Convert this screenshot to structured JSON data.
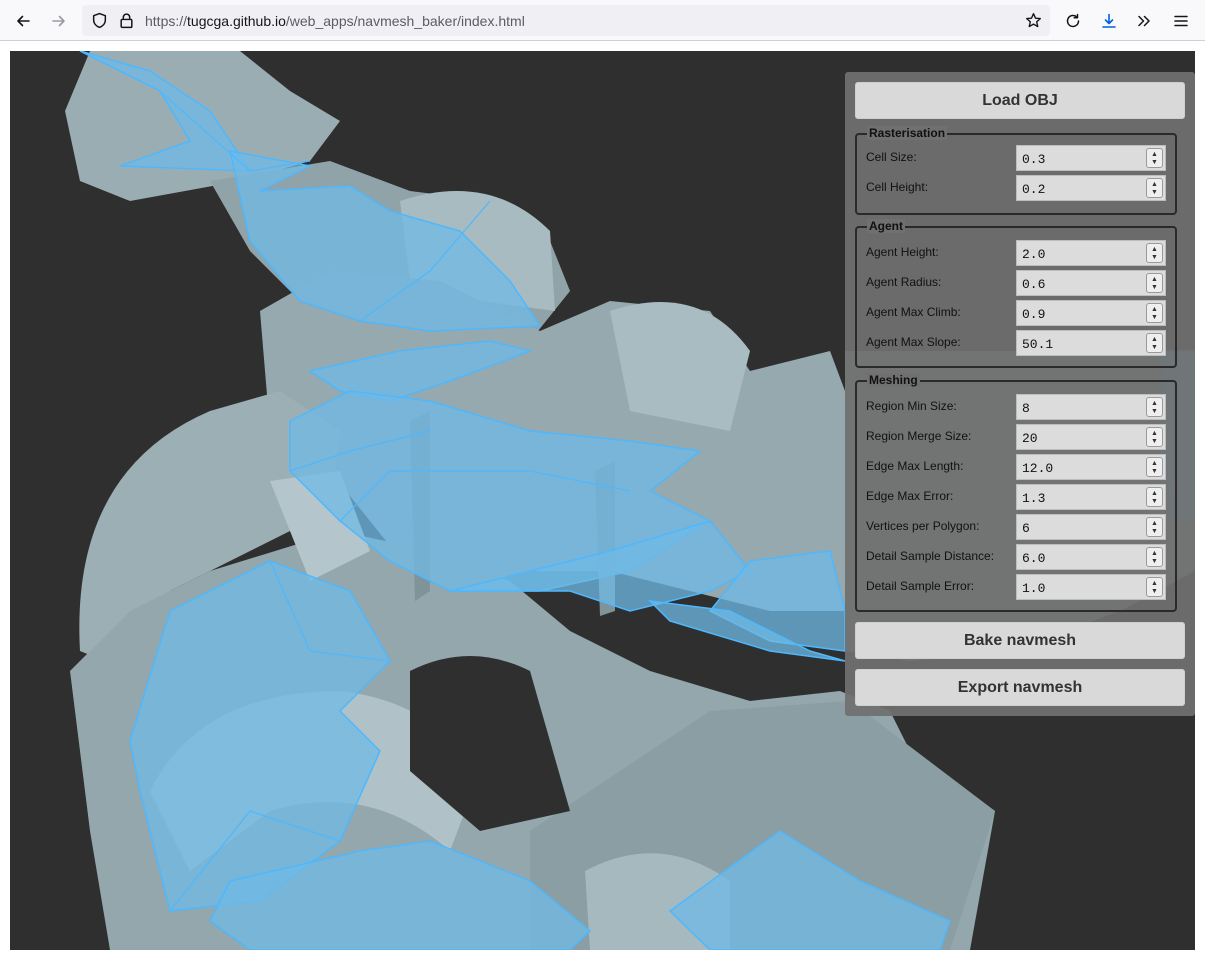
{
  "browser": {
    "url_prefix": "https://",
    "url_host": "tugcga.github.io",
    "url_path": "/web_apps/navmesh_baker/index.html",
    "icons": [
      "back-arrow-icon",
      "forward-arrow-icon",
      "shield-icon",
      "lock-icon",
      "star-icon",
      "reload-icon",
      "download-icon",
      "overflow-chevrons-icon",
      "hamburger-menu-icon"
    ],
    "download_icon_color": "#0061e0"
  },
  "scene": {
    "background_color": "#2f2f2f",
    "mesh_color": "#9eb2b7",
    "navmesh_fill": "#6fb9e6",
    "navmesh_edge": "#4db8ff"
  },
  "panel": {
    "load_button": "Load OBJ",
    "bake_button": "Bake navmesh",
    "export_button": "Export navmesh",
    "groups": [
      {
        "title": "Rasterisation",
        "fields": [
          {
            "label": "Cell Size:",
            "value": "0.3"
          },
          {
            "label": "Cell Height:",
            "value": "0.2"
          }
        ]
      },
      {
        "title": "Agent",
        "fields": [
          {
            "label": "Agent Height:",
            "value": "2.0"
          },
          {
            "label": "Agent Radius:",
            "value": "0.6"
          },
          {
            "label": "Agent Max Climb:",
            "value": "0.9"
          },
          {
            "label": "Agent Max Slope:",
            "value": "50.1"
          }
        ]
      },
      {
        "title": "Meshing",
        "fields": [
          {
            "label": "Region Min Size:",
            "value": "8"
          },
          {
            "label": "Region Merge Size:",
            "value": "20"
          },
          {
            "label": "Edge Max Length:",
            "value": "12.0"
          },
          {
            "label": "Edge Max Error:",
            "value": "1.3"
          },
          {
            "label": "Vertices per Polygon:",
            "value": "6"
          },
          {
            "label": "Detail Sample Distance:",
            "value": "6.0"
          },
          {
            "label": "Detail Sample Error:",
            "value": "1.0"
          }
        ]
      }
    ]
  }
}
